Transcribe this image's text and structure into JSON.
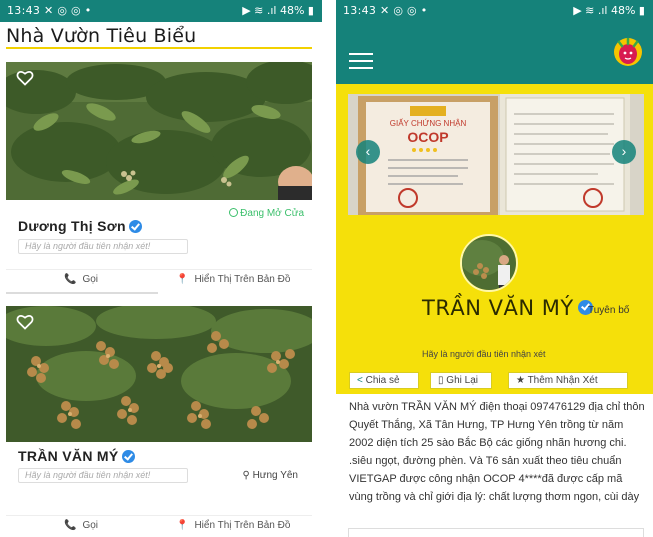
{
  "status_bar": {
    "time": "13:43",
    "left_icons": "✕ ◎ ◎ •",
    "battery": "48%",
    "right_icons": "▶ ≋ .ıl"
  },
  "list_screen": {
    "title": "Nhà Vườn Tiêu Biểu",
    "cards": [
      {
        "name": "Dương Thị Sơn",
        "verified": true,
        "status": "Đang Mở Cửa",
        "comment_placeholder": "Hãy là người đầu tiên nhận xét!",
        "call_label": "Gọi",
        "map_label": "Hiển Thị Trên Bản Đồ"
      },
      {
        "name": "TRẦN VĂN MÝ",
        "verified": true,
        "location": "Hưng Yên",
        "comment_placeholder": "Hãy là người đầu tiên nhận xét!",
        "call_label": "Gọi",
        "map_label": "Hiển Thị Trên Bản Đồ"
      }
    ]
  },
  "detail_screen": {
    "owner_name": "TRẦN VĂN MÝ",
    "declare_label": "Tuyên bố",
    "first_comment": "Hãy là người đầu tiên nhận xét",
    "certificate_texts": {
      "heading": "GIẤY CHỨNG NHẬN",
      "brand": "OCOP"
    },
    "buttons": {
      "share": "Chia sẻ",
      "save": "Ghi Lại",
      "review": "Thêm Nhận Xét"
    },
    "description": "Nhà vườn TRẦN VĂN MÝ điện thoại 097476129 địa chỉ thôn Quyết Thắng, Xã Tân Hưng, TP Hưng Yên trồng từ năm 2002 diện tích 25 sào Bắc Bộ các giống nhãn hương chi. .siêu ngọt, đường phèn. Và T6 sản xuất theo tiêu chuẩn VIETGAP được công nhận OCOP 4****đã được cấp mã vùng trồng và chỉ giới địa lý: chất lượng thơm ngon, cùi dày"
  },
  "colors": {
    "teal": "#15827a",
    "yellow": "#f5e00a",
    "open_green": "#3bbf6b",
    "verified_blue": "#2e8be6"
  }
}
